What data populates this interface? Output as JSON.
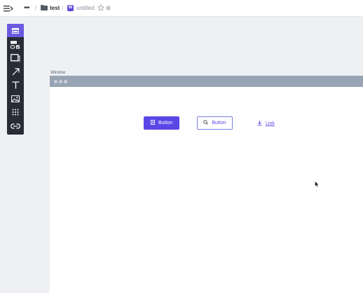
{
  "topbar": {
    "menu_icon": "sidebar-toggle-icon",
    "more_label": "•••",
    "separator": "/",
    "folder_icon": "folder-icon",
    "folder_name": "test",
    "file_badge": "W",
    "file_name": "untitled",
    "star_icon": "star-icon",
    "status_icon": "settings-icon"
  },
  "palette": {
    "tools": [
      {
        "name": "window",
        "icon": "window-icon"
      },
      {
        "name": "form",
        "icon": "form-icon"
      },
      {
        "name": "container",
        "icon": "box-icon"
      },
      {
        "name": "arrow",
        "icon": "arrow-icon"
      },
      {
        "name": "text",
        "icon": "text-icon"
      },
      {
        "name": "image",
        "icon": "image-icon"
      },
      {
        "name": "grid",
        "icon": "grid-icon"
      },
      {
        "name": "link",
        "icon": "link-icon"
      }
    ],
    "active_index": 0
  },
  "canvas": {
    "window_label": "Window",
    "primary_button_label": "Button",
    "secondary_button_label": "Button",
    "link_label": "Link"
  },
  "colors": {
    "accent": "#5a47e6",
    "palette_bg": "#272c36",
    "titlebar": "#98a4b3",
    "canvas_bg": "#eef0f4"
  }
}
